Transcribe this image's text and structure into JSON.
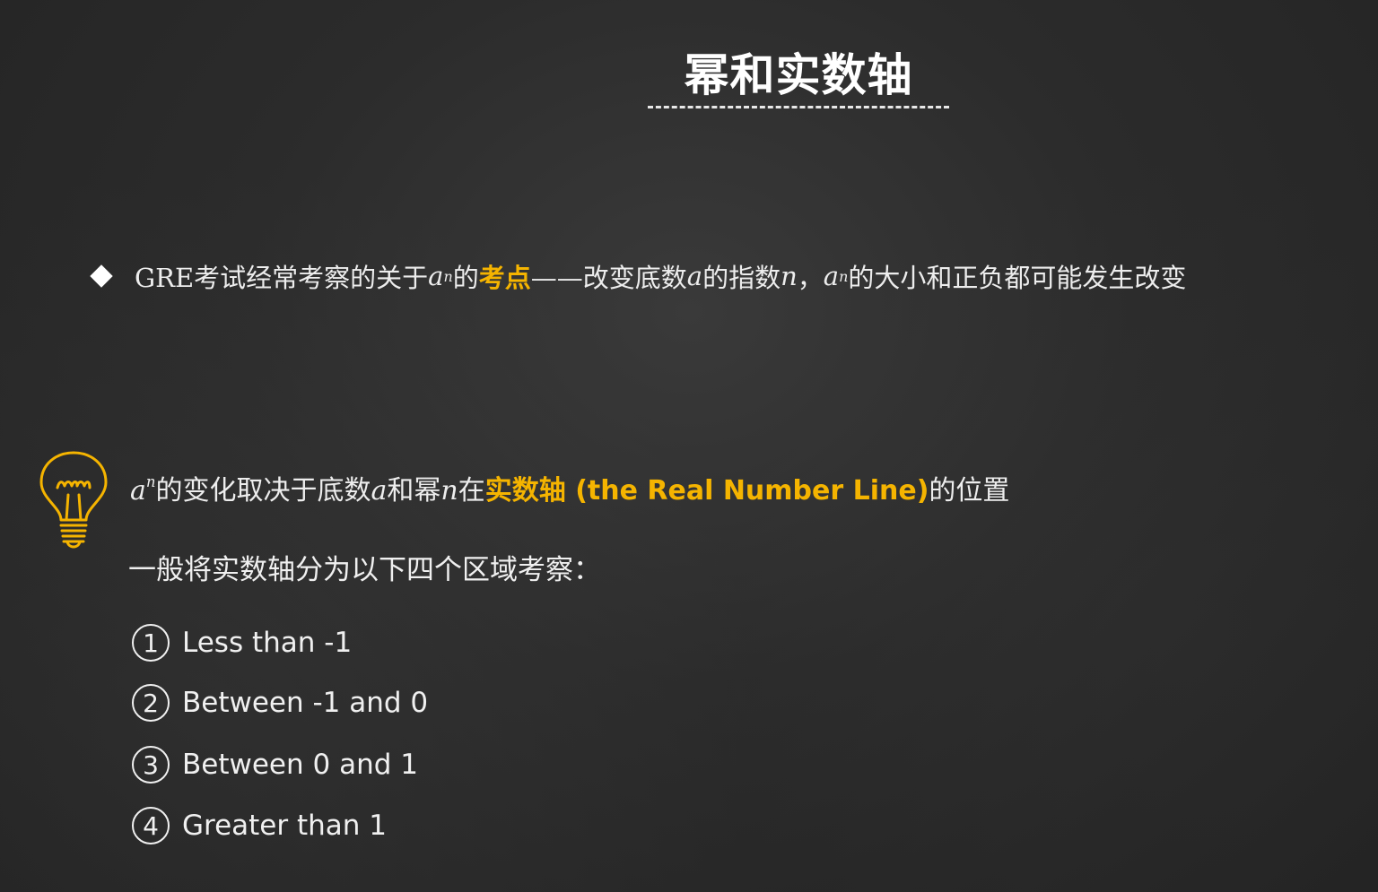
{
  "title": "幂和实数轴",
  "bullet": {
    "p1": "GRE考试经常考察的关于",
    "a": "a",
    "n": "n",
    "p2": "的",
    "highlight": "考点",
    "p3": "——改变底数",
    "a2": "a",
    "p4": "的指数",
    "n2": "n",
    "p5": "，",
    "a3": "a",
    "n3": "n",
    "p6": "的大小和正负都可能发生改变"
  },
  "tip": {
    "a": "a",
    "n": "n",
    "p1": "的变化取决于底数",
    "a2": "a",
    "p2": "和幂",
    "n2": "n",
    "p3": "在",
    "highlight": "实数轴 (the Real Number Line)",
    "p4": "的位置",
    "intro": "一般将实数轴分为以下四个区域考察："
  },
  "items": [
    {
      "num": "1",
      "label": "Less than -1"
    },
    {
      "num": "2",
      "label": "Between -1 and 0"
    },
    {
      "num": "3",
      "label": "Between 0 and 1"
    },
    {
      "num": "4",
      "label": "Greater than 1"
    }
  ],
  "colors": {
    "accent": "#f5b400",
    "text": "#f0f0f0",
    "background": "#2b2b2b"
  },
  "icons": {
    "bullet": "diamond-icon",
    "tip": "lightbulb-icon"
  }
}
